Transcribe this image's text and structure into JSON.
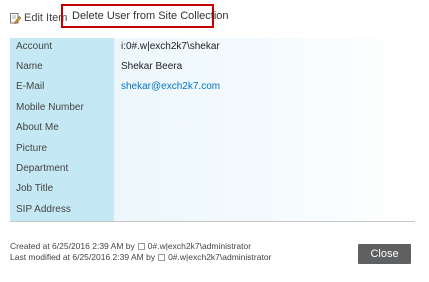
{
  "toolbar": {
    "edit_label": "Edit Item",
    "edit_icon": "edit-document-icon",
    "delete_label": "Delete User from Site Collection",
    "delete_icon": "x-close-icon",
    "highlight_color": "#c00000"
  },
  "fields": [
    {
      "label": "Account",
      "value": "i:0#.w|exch2k7\\shekar"
    },
    {
      "label": "Name",
      "value": "Shekar Beera"
    },
    {
      "label": "E-Mail",
      "value": "shekar@exch2k7.com"
    },
    {
      "label": "Mobile Number",
      "value": ""
    },
    {
      "label": "About Me",
      "value": ""
    },
    {
      "label": "Picture",
      "value": ""
    },
    {
      "label": "Department",
      "value": ""
    },
    {
      "label": "Job Title",
      "value": ""
    },
    {
      "label": "SIP Address",
      "value": ""
    }
  ],
  "footer": {
    "created_prefix": "Created at 6/25/2016 2:39 AM  by",
    "created_user": "0#.w|exch2k7\\administrator",
    "modified_prefix": "Last modified at 6/25/2016 2:39 AM  by",
    "modified_user": "0#.w|exch2k7\\administrator"
  },
  "close_label": "Close",
  "colors": {
    "label_column": "#c5e9f4",
    "link": "#0072c6",
    "close_button": "#5f6062"
  }
}
